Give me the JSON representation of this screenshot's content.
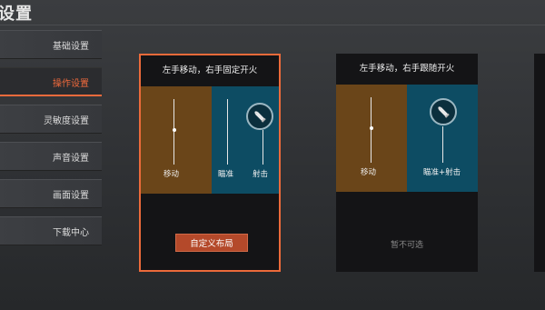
{
  "header": {
    "title": "设置"
  },
  "sidebar": {
    "items": [
      {
        "label": "基础设置"
      },
      {
        "label": "操作设置"
      },
      {
        "label": "灵敏度设置"
      },
      {
        "label": "声音设置"
      },
      {
        "label": "画面设置"
      },
      {
        "label": "下载中心"
      }
    ],
    "active_index": 1
  },
  "layouts": [
    {
      "title": "左手移动，右手固定开火",
      "move_label": "移动",
      "aim_label": "瞄准",
      "fire_label": "射击",
      "button_label": "自定义布局",
      "selected": true
    },
    {
      "title": "左手移动，右手跟随开火",
      "move_label": "移动",
      "aim_fire_label": "瞄准+射击",
      "status": "暂不可选",
      "selected": false
    }
  ],
  "colors": {
    "accent": "#ec6a3a",
    "move_zone": "#6a4519",
    "aim_zone": "#0d4c63",
    "button": "#b4492a"
  },
  "icons": {
    "fire": "bullet-icon"
  }
}
